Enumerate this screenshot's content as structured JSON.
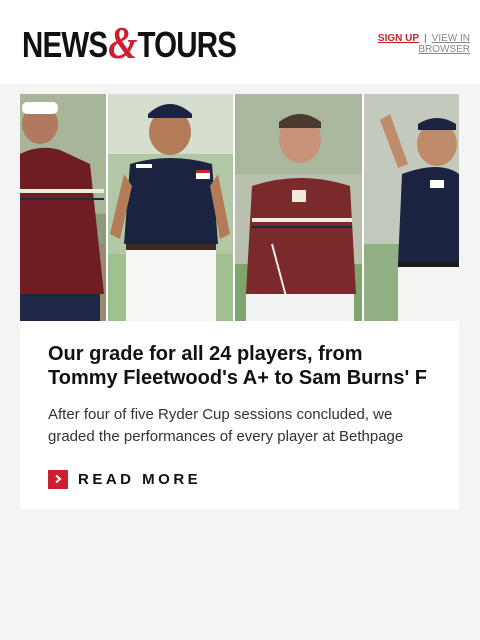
{
  "header": {
    "logo_left": "NEWS",
    "logo_amp": "&",
    "logo_right": "TOURS",
    "signup_label": "SIGN UP",
    "separator": "|",
    "view_in_browser_label": "VIEW IN BROWSER"
  },
  "article": {
    "image_alt": "Ryder Cup players",
    "headline": "Our grade for all 24 players, from\nTommy Fleetwood's A+ to Sam Burns' F",
    "summary": "After four of five Ryder Cup sessions concluded, we\ngraded the performances of every player at Bethpage",
    "read_more_label": "READ MORE"
  },
  "colors": {
    "accent": "#cf1f2e",
    "text": "#111111",
    "background": "#f4f4f4"
  }
}
